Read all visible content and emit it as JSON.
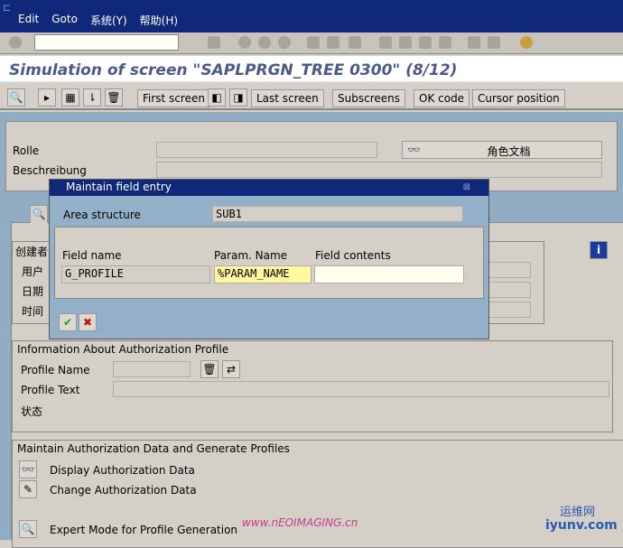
{
  "menu": [
    "Edit",
    "Goto",
    "系统(Y)",
    "帮助(H)"
  ],
  "title": "Simulation of screen \"SAPLPRGN_TREE 0300\" (8/12)",
  "toolbar": {
    "first_screen": "First screen",
    "last_screen": "Last screen",
    "subscreens": "Subscreens",
    "ok_code": "OK code",
    "cursor_position": "Cursor position"
  },
  "header": {
    "rolle": "Rolle",
    "beschreibung": "Beschreibung",
    "doc_button": "角色文档"
  },
  "creator": {
    "title": "创建者",
    "user": "用户",
    "date": "日期",
    "time": "时间"
  },
  "auth_profile": {
    "title": "Information About Authorization Profile",
    "profile_name": "Profile Name",
    "profile_text": "Profile Text",
    "status": "状态"
  },
  "maintain": {
    "title": "Maintain Authorization Data and Generate Profiles",
    "display": "Display Authorization Data",
    "change": "Change Authorization Data",
    "expert": "Expert Mode for Profile Generation"
  },
  "dialog": {
    "title": "Maintain field entry",
    "area_label": "Area structure",
    "area_value": "SUB1",
    "col_field": "Field name",
    "col_param": "Param. Name",
    "col_contents": "Field contents",
    "field_value": "G_PROFILE",
    "param_value": "%PARAM_NAME",
    "contents_value": ""
  },
  "watermark": {
    "site1": "www.nEOIMAGING.cn",
    "site2": "运维网",
    "site3": "iyunv.com"
  }
}
